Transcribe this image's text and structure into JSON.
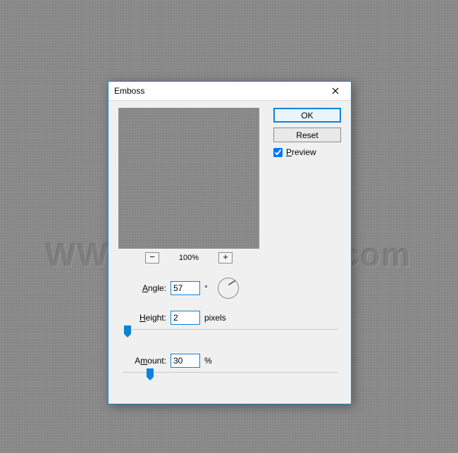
{
  "watermark": "WWW.PSD-DUDE.com",
  "dialog": {
    "title": "Emboss",
    "buttons": {
      "ok": "OK",
      "reset": "Reset"
    },
    "preview_label": "Preview",
    "preview_checked": true,
    "zoom": {
      "minus": "−",
      "level": "100%",
      "plus": "+"
    },
    "angle": {
      "label": "Angle:",
      "value": "57",
      "unit": "°"
    },
    "height": {
      "label": "Height:",
      "value": "2",
      "unit": "pixels"
    },
    "amount": {
      "label": "Amount:",
      "value": "30",
      "unit": "%"
    }
  }
}
